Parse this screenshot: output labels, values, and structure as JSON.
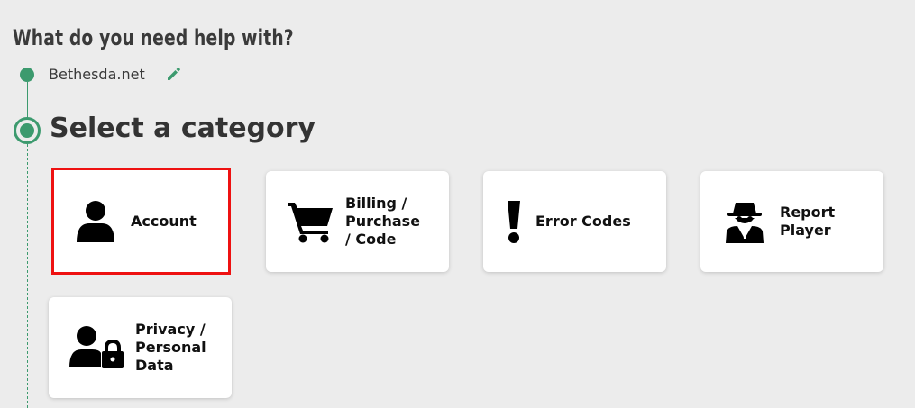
{
  "page": {
    "heading": "What do you need help with?"
  },
  "breadcrumb": {
    "product": "Bethesda.net"
  },
  "section": {
    "title": "Select a category"
  },
  "categories": [
    {
      "label": "Account",
      "icon": "user-icon"
    },
    {
      "label": "Billing /\nPurchase\n/ Code",
      "icon": "cart-icon"
    },
    {
      "label": "Error Codes",
      "icon": "exclamation-icon"
    },
    {
      "label": "Report\nPlayer",
      "icon": "spy-icon"
    },
    {
      "label": "Privacy /\nPersonal\nData",
      "icon": "user-lock-icon"
    }
  ],
  "selected_category": "Account",
  "colors": {
    "accent": "#3c9a6e",
    "selection": "#ee1111"
  }
}
